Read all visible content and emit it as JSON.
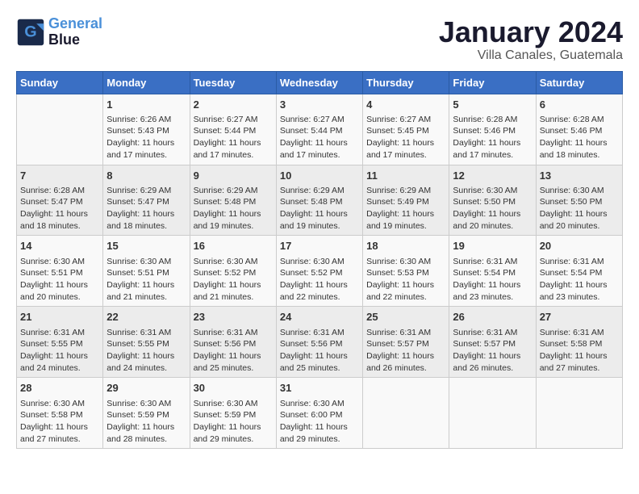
{
  "logo": {
    "line1": "General",
    "line2": "Blue"
  },
  "title": "January 2024",
  "location": "Villa Canales, Guatemala",
  "weekdays": [
    "Sunday",
    "Monday",
    "Tuesday",
    "Wednesday",
    "Thursday",
    "Friday",
    "Saturday"
  ],
  "weeks": [
    [
      {
        "day": null,
        "info": null
      },
      {
        "day": "1",
        "info": "Sunrise: 6:26 AM\nSunset: 5:43 PM\nDaylight: 11 hours\nand 17 minutes."
      },
      {
        "day": "2",
        "info": "Sunrise: 6:27 AM\nSunset: 5:44 PM\nDaylight: 11 hours\nand 17 minutes."
      },
      {
        "day": "3",
        "info": "Sunrise: 6:27 AM\nSunset: 5:44 PM\nDaylight: 11 hours\nand 17 minutes."
      },
      {
        "day": "4",
        "info": "Sunrise: 6:27 AM\nSunset: 5:45 PM\nDaylight: 11 hours\nand 17 minutes."
      },
      {
        "day": "5",
        "info": "Sunrise: 6:28 AM\nSunset: 5:46 PM\nDaylight: 11 hours\nand 17 minutes."
      },
      {
        "day": "6",
        "info": "Sunrise: 6:28 AM\nSunset: 5:46 PM\nDaylight: 11 hours\nand 18 minutes."
      }
    ],
    [
      {
        "day": "7",
        "info": "Sunrise: 6:28 AM\nSunset: 5:47 PM\nDaylight: 11 hours\nand 18 minutes."
      },
      {
        "day": "8",
        "info": "Sunrise: 6:29 AM\nSunset: 5:47 PM\nDaylight: 11 hours\nand 18 minutes."
      },
      {
        "day": "9",
        "info": "Sunrise: 6:29 AM\nSunset: 5:48 PM\nDaylight: 11 hours\nand 19 minutes."
      },
      {
        "day": "10",
        "info": "Sunrise: 6:29 AM\nSunset: 5:48 PM\nDaylight: 11 hours\nand 19 minutes."
      },
      {
        "day": "11",
        "info": "Sunrise: 6:29 AM\nSunset: 5:49 PM\nDaylight: 11 hours\nand 19 minutes."
      },
      {
        "day": "12",
        "info": "Sunrise: 6:30 AM\nSunset: 5:50 PM\nDaylight: 11 hours\nand 20 minutes."
      },
      {
        "day": "13",
        "info": "Sunrise: 6:30 AM\nSunset: 5:50 PM\nDaylight: 11 hours\nand 20 minutes."
      }
    ],
    [
      {
        "day": "14",
        "info": "Sunrise: 6:30 AM\nSunset: 5:51 PM\nDaylight: 11 hours\nand 20 minutes."
      },
      {
        "day": "15",
        "info": "Sunrise: 6:30 AM\nSunset: 5:51 PM\nDaylight: 11 hours\nand 21 minutes."
      },
      {
        "day": "16",
        "info": "Sunrise: 6:30 AM\nSunset: 5:52 PM\nDaylight: 11 hours\nand 21 minutes."
      },
      {
        "day": "17",
        "info": "Sunrise: 6:30 AM\nSunset: 5:52 PM\nDaylight: 11 hours\nand 22 minutes."
      },
      {
        "day": "18",
        "info": "Sunrise: 6:30 AM\nSunset: 5:53 PM\nDaylight: 11 hours\nand 22 minutes."
      },
      {
        "day": "19",
        "info": "Sunrise: 6:31 AM\nSunset: 5:54 PM\nDaylight: 11 hours\nand 23 minutes."
      },
      {
        "day": "20",
        "info": "Sunrise: 6:31 AM\nSunset: 5:54 PM\nDaylight: 11 hours\nand 23 minutes."
      }
    ],
    [
      {
        "day": "21",
        "info": "Sunrise: 6:31 AM\nSunset: 5:55 PM\nDaylight: 11 hours\nand 24 minutes."
      },
      {
        "day": "22",
        "info": "Sunrise: 6:31 AM\nSunset: 5:55 PM\nDaylight: 11 hours\nand 24 minutes."
      },
      {
        "day": "23",
        "info": "Sunrise: 6:31 AM\nSunset: 5:56 PM\nDaylight: 11 hours\nand 25 minutes."
      },
      {
        "day": "24",
        "info": "Sunrise: 6:31 AM\nSunset: 5:56 PM\nDaylight: 11 hours\nand 25 minutes."
      },
      {
        "day": "25",
        "info": "Sunrise: 6:31 AM\nSunset: 5:57 PM\nDaylight: 11 hours\nand 26 minutes."
      },
      {
        "day": "26",
        "info": "Sunrise: 6:31 AM\nSunset: 5:57 PM\nDaylight: 11 hours\nand 26 minutes."
      },
      {
        "day": "27",
        "info": "Sunrise: 6:31 AM\nSunset: 5:58 PM\nDaylight: 11 hours\nand 27 minutes."
      }
    ],
    [
      {
        "day": "28",
        "info": "Sunrise: 6:30 AM\nSunset: 5:58 PM\nDaylight: 11 hours\nand 27 minutes."
      },
      {
        "day": "29",
        "info": "Sunrise: 6:30 AM\nSunset: 5:59 PM\nDaylight: 11 hours\nand 28 minutes."
      },
      {
        "day": "30",
        "info": "Sunrise: 6:30 AM\nSunset: 5:59 PM\nDaylight: 11 hours\nand 29 minutes."
      },
      {
        "day": "31",
        "info": "Sunrise: 6:30 AM\nSunset: 6:00 PM\nDaylight: 11 hours\nand 29 minutes."
      },
      {
        "day": null,
        "info": null
      },
      {
        "day": null,
        "info": null
      },
      {
        "day": null,
        "info": null
      }
    ]
  ]
}
